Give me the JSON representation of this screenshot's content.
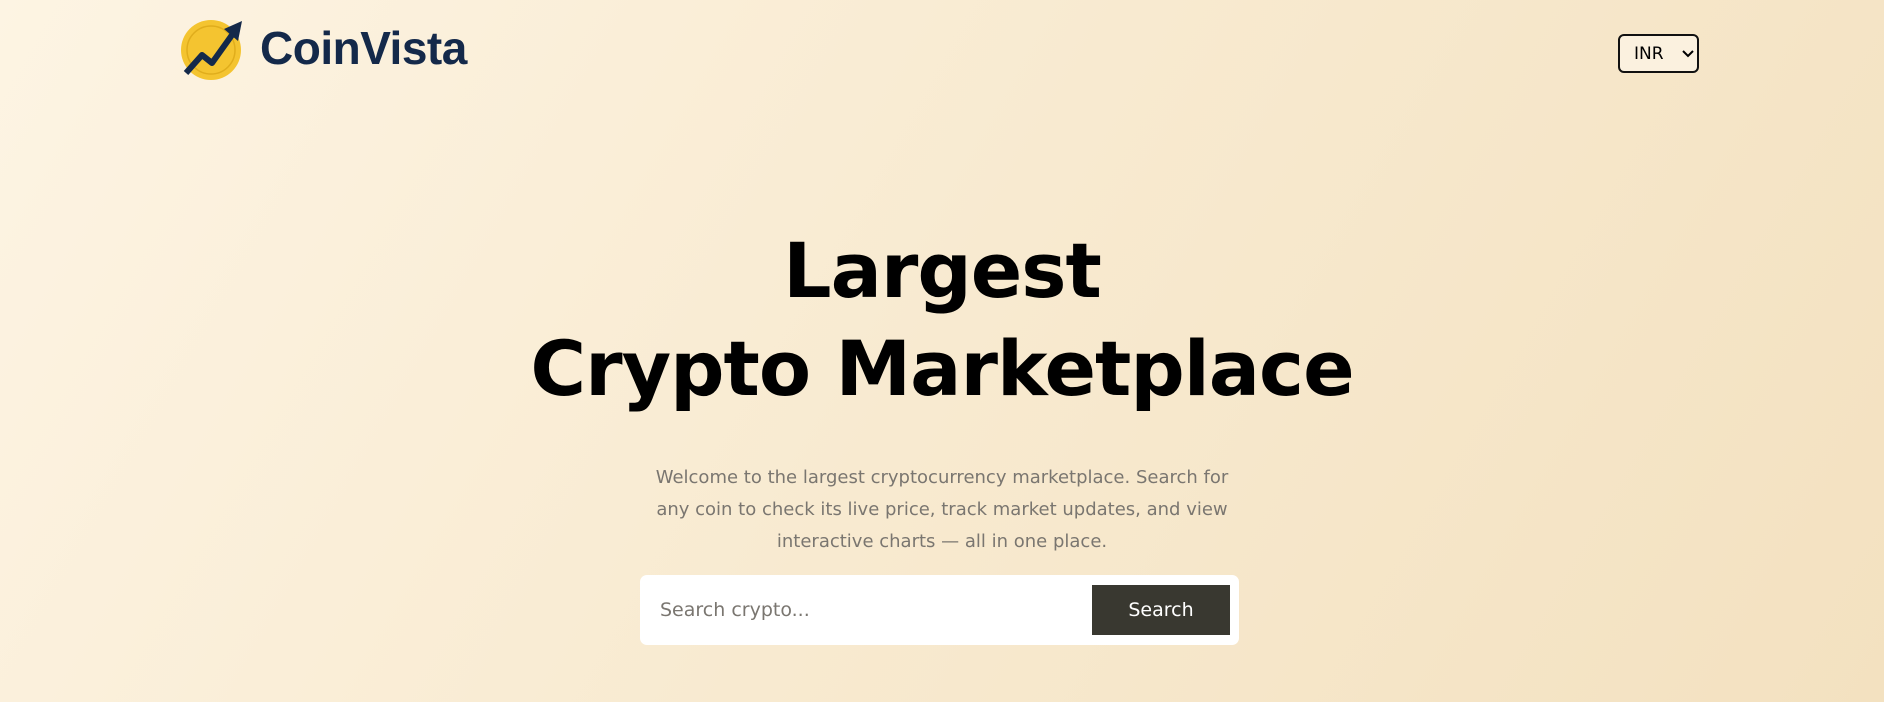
{
  "brand": {
    "name": "CoinVista",
    "logo_colors": {
      "coin": "#f4c430",
      "arrow": "#14294a"
    }
  },
  "currency": {
    "selected": "INR",
    "icon": "chevron-down-icon"
  },
  "hero": {
    "title_line1": "Largest",
    "title_line2": "Crypto Marketplace",
    "description": "Welcome to the largest cryptocurrency marketplace. Search for any coin to check its live price, track market updates, and view interactive charts — all in one place."
  },
  "search": {
    "placeholder": "Search crypto...",
    "value": "",
    "button_label": "Search"
  }
}
